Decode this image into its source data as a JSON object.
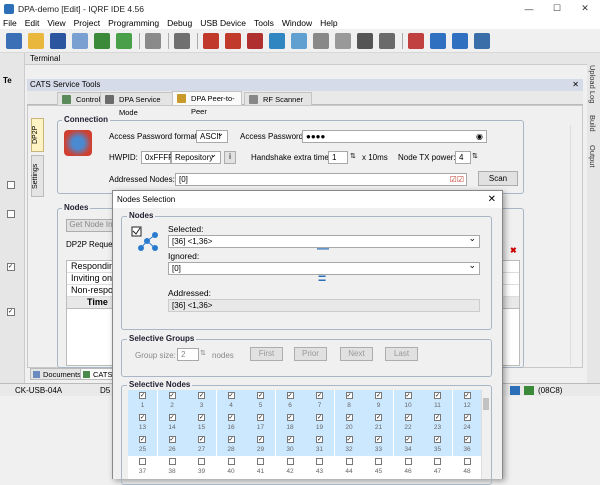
{
  "window": {
    "title": "DPA-demo [Edit] - IQRF IDE 4.56"
  },
  "menu": [
    "File",
    "Edit",
    "View",
    "Project",
    "Programming",
    "Debug",
    "USB Device",
    "Tools",
    "Window",
    "Help"
  ],
  "toolbar": {
    "icons": [
      "new-project-icon",
      "open-icon",
      "save-icon",
      "build-icon",
      "check-icon",
      "upload-icon",
      "settings-icon",
      "tools-icon",
      "terminal-icon",
      "antenna-icon",
      "network-icon",
      "iqmesh-icon",
      "sensor-icon",
      "service-icon",
      "rf-icon",
      "qr-icon",
      "list-icon",
      "wrench-icon",
      "usb-icon",
      "tr-icon",
      "help-icon"
    ]
  },
  "left_strip": {
    "marker": "Te"
  },
  "terminal": {
    "title": "Terminal"
  },
  "right_tabs": [
    "Upload Log",
    "Build",
    "Output"
  ],
  "cats": {
    "title": "CATS Service Tools",
    "tabs": [
      {
        "label": "Control"
      },
      {
        "label": "DPA Service Mode"
      },
      {
        "label": "DPA Peer-to-Peer"
      },
      {
        "label": "RF Scanner"
      }
    ],
    "side_tabs": [
      "DP2P",
      "Settings"
    ],
    "connection": {
      "title": "Connection",
      "pwd_format_label": "Access Password format:",
      "pwd_format_value": "ASCII",
      "pwd_label": "Access Password:",
      "pwd_value": "●●●●",
      "hwpid_label": "HWPID:",
      "hwpid_value": "0xFFFF",
      "repository_label": "Repository",
      "handshake_label": "Handshake extra time:",
      "handshake_value": "1",
      "handshake_unit": "x 10ms",
      "txpower_label": "Node TX power:",
      "txpower_value": "4",
      "addressed_label": "Addressed Nodes:",
      "addressed_value": "[0]",
      "scan_label": "Scan"
    },
    "nodes": {
      "title": "Nodes",
      "get_node_info": "Get Node In",
      "dp2p_request": "DP2P Request",
      "rows": [
        "Responding",
        "Inviting only",
        "Non-respond"
      ],
      "time_header": "Time"
    }
  },
  "bottom_tabs": [
    "Documents",
    "CATS S"
  ],
  "status": {
    "device": "CK-USB-04A",
    "d5": "D5",
    "right": "(08C8)"
  },
  "dialog": {
    "title": "Nodes Selection",
    "nodes_group": "Nodes",
    "selected_label": "Selected:",
    "selected_value": "[36]  <1,36>",
    "ignored_label": "Ignored:",
    "ignored_value": "[0]",
    "minus": "—",
    "equals": "=",
    "addressed_label": "Addressed:",
    "addressed_value": "[36]  <1,36>",
    "groups_title": "Selective Groups",
    "group_size_label": "Group size:",
    "group_size_value": "2",
    "nodes_unit": "nodes",
    "first": "First",
    "prior": "Prior",
    "next": "Next",
    "last": "Last",
    "selective_title": "Selective Nodes",
    "grid_numbers": [
      "1",
      "2",
      "3",
      "4",
      "5",
      "6",
      "7",
      "8",
      "9",
      "10",
      "11",
      "12",
      "13",
      "14",
      "15",
      "16",
      "17",
      "18",
      "19",
      "20",
      "21",
      "22",
      "23",
      "24",
      "25",
      "26",
      "27",
      "28",
      "29",
      "30",
      "31",
      "32",
      "33",
      "34",
      "35",
      "36",
      "37",
      "38",
      "39",
      "40",
      "41",
      "42",
      "43",
      "44",
      "45",
      "46",
      "47",
      "48"
    ],
    "checked_count": 36
  },
  "colors": {
    "accent": "#2a6fb8",
    "selected_row": "#cce8ff",
    "tab_header": "#d6dbe9"
  }
}
